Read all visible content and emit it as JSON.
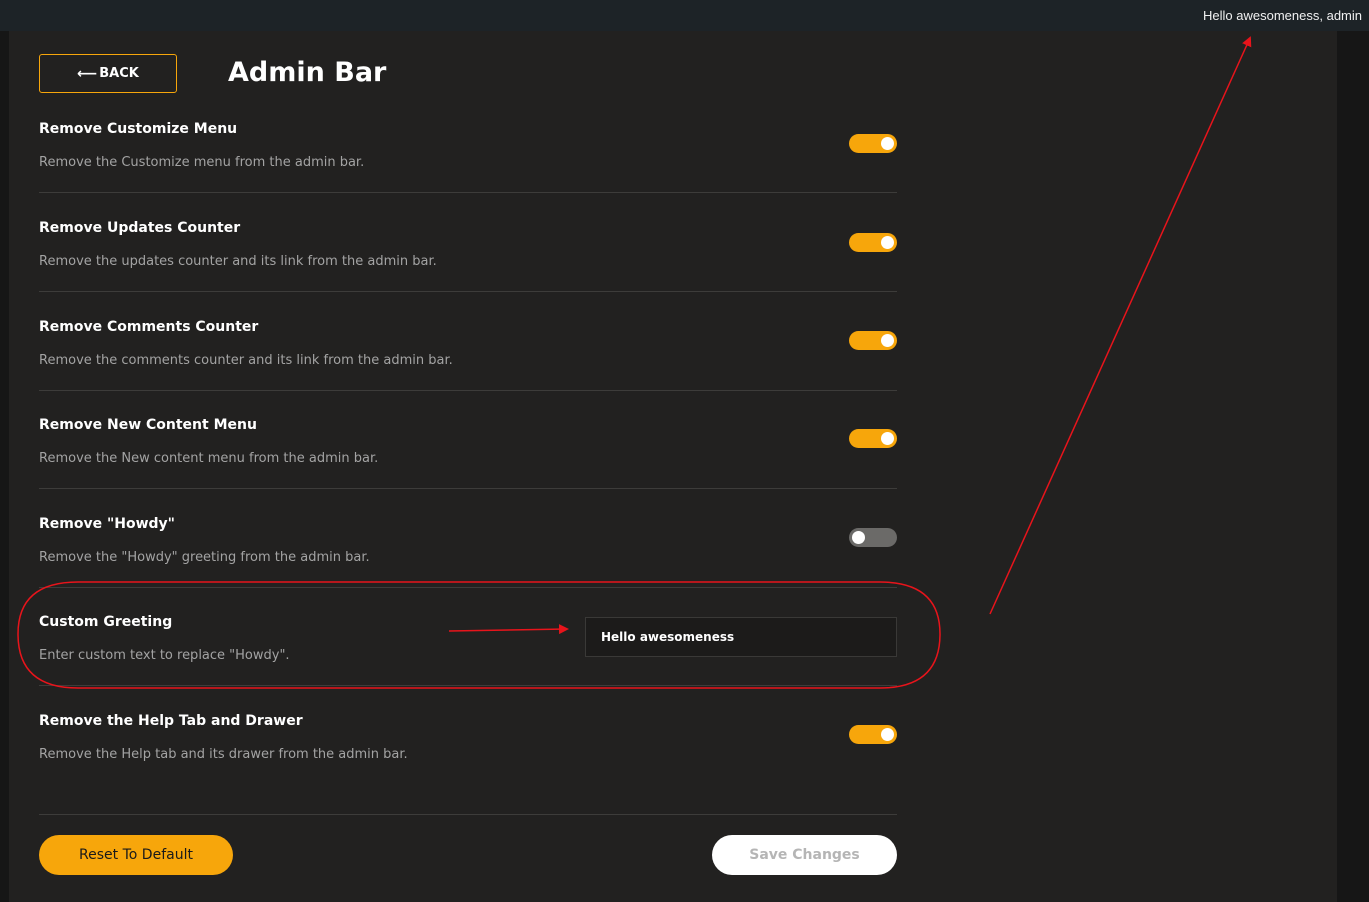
{
  "admin_bar": {
    "greeting": "Hello awesomeness, admin"
  },
  "header": {
    "back_label": "BACK",
    "back_arrow": "⟵",
    "title": "Admin Bar"
  },
  "settings": [
    {
      "title": "Remove Customize Menu",
      "description": "Remove the Customize menu from the admin bar.",
      "enabled": true
    },
    {
      "title": "Remove Updates Counter",
      "description": "Remove the updates counter and its link from the admin bar.",
      "enabled": true
    },
    {
      "title": "Remove Comments Counter",
      "description": "Remove the comments counter and its link from the admin bar.",
      "enabled": true
    },
    {
      "title": "Remove New Content Menu",
      "description": "Remove the New content menu from the admin bar.",
      "enabled": true
    },
    {
      "title": "Remove \"Howdy\"",
      "description": "Remove the \"Howdy\" greeting from the admin bar.",
      "enabled": false
    },
    {
      "title": "Custom Greeting",
      "description": "Enter custom text to replace \"Howdy\".",
      "value": "Hello awesomeness"
    },
    {
      "title": "Remove the Help Tab and Drawer",
      "description": "Remove the Help tab and its drawer from the admin bar.",
      "enabled": true
    }
  ],
  "footer": {
    "reset_label": "Reset To Default",
    "save_label": "Save Changes"
  },
  "colors": {
    "accent": "#f7a60b",
    "annotation": "#e8141b"
  }
}
